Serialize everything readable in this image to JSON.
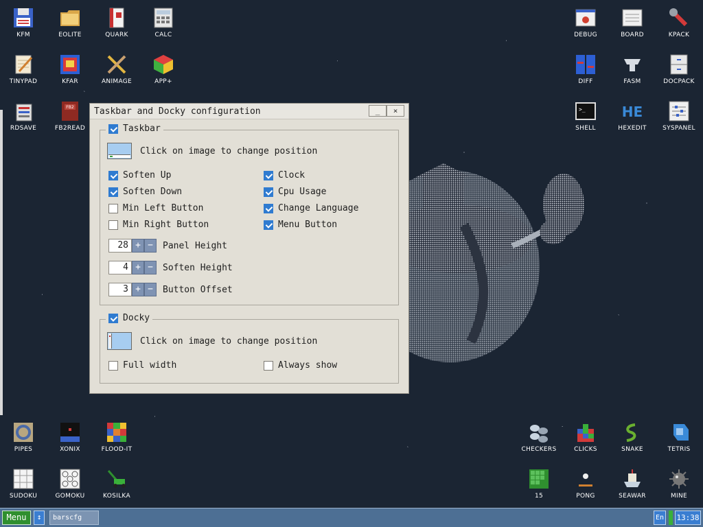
{
  "desktop": {
    "icons": [
      {
        "label": "KFM",
        "icon": "floppy-disk-icon"
      },
      {
        "label": "EOLITE",
        "icon": "folder-icon"
      },
      {
        "label": "QUARK",
        "icon": "book-icon"
      },
      {
        "label": "CALC",
        "icon": "calculator-icon"
      },
      {
        "label": "TINYPAD",
        "icon": "notepad-icon"
      },
      {
        "label": "KFAR",
        "icon": "archive-icon"
      },
      {
        "label": "ANIMAGE",
        "icon": "paint-tools-icon"
      },
      {
        "label": "APP+",
        "icon": "cube-icon"
      },
      {
        "label": "RDSAVE",
        "icon": "disk-save-icon"
      },
      {
        "label": "FB2READ",
        "icon": "ebook-icon"
      },
      {
        "label": "DEBUG",
        "icon": "bug-icon"
      },
      {
        "label": "BOARD",
        "icon": "board-icon"
      },
      {
        "label": "KPACK",
        "icon": "wrench-icon"
      },
      {
        "label": "DIFF",
        "icon": "diff-icon"
      },
      {
        "label": "FASM",
        "icon": "anvil-icon"
      },
      {
        "label": "DOCPACK",
        "icon": "cabinet-icon"
      },
      {
        "label": "SHELL",
        "icon": "terminal-icon"
      },
      {
        "label": "HEXEDIT",
        "icon": "hex-editor-icon"
      },
      {
        "label": "SYSPANEL",
        "icon": "sliders-icon"
      },
      {
        "label": "PIPES",
        "icon": "pipes-icon"
      },
      {
        "label": "XONIX",
        "icon": "xonix-icon"
      },
      {
        "label": "FLOOD-IT",
        "icon": "color-grid-icon"
      },
      {
        "label": "SUDOKU",
        "icon": "sudoku-icon"
      },
      {
        "label": "GOMOKU",
        "icon": "gomoku-icon"
      },
      {
        "label": "KOSILKA",
        "icon": "lawnmower-icon"
      },
      {
        "label": "CHECKERS",
        "icon": "checkers-icon"
      },
      {
        "label": "CLICKS",
        "icon": "blocks-icon"
      },
      {
        "label": "SNAKE",
        "icon": "snake-icon"
      },
      {
        "label": "TETRIS",
        "icon": "tetris-icon"
      },
      {
        "label": "15",
        "icon": "fifteen-puzzle-icon"
      },
      {
        "label": "PONG",
        "icon": "pong-icon"
      },
      {
        "label": "SEAWAR",
        "icon": "ship-icon"
      },
      {
        "label": "MINE",
        "icon": "mine-icon"
      }
    ]
  },
  "window": {
    "title": "Taskbar and Docky configuration",
    "minimize_label": "_",
    "close_label": "×",
    "taskbar_group": {
      "label": "Taskbar",
      "checked": true,
      "position_hint": "Click on image to change position",
      "options": [
        {
          "label": "Soften Up",
          "checked": true
        },
        {
          "label": "Soften Down",
          "checked": true
        },
        {
          "label": "Min Left Button",
          "checked": false
        },
        {
          "label": "Min Right Button",
          "checked": false
        },
        {
          "label": "Clock",
          "checked": true
        },
        {
          "label": "Cpu Usage",
          "checked": true
        },
        {
          "label": "Change Language",
          "checked": true
        },
        {
          "label": "Menu Button",
          "checked": true
        }
      ],
      "spinners": [
        {
          "value": "28",
          "label": "Panel Height"
        },
        {
          "value": "4",
          "label": "Soften Height"
        },
        {
          "value": "3",
          "label": "Button Offset"
        }
      ],
      "plus": "+",
      "minus": "−"
    },
    "docky_group": {
      "label": "Docky",
      "checked": true,
      "position_hint": "Click on image to change position",
      "options": [
        {
          "label": "Full width",
          "checked": false
        },
        {
          "label": "Always show",
          "checked": false
        }
      ]
    }
  },
  "taskbar": {
    "menu_label": "Menu",
    "switch_label": "↕",
    "task_item": "barscfg",
    "language": "En",
    "time": "13:38"
  }
}
